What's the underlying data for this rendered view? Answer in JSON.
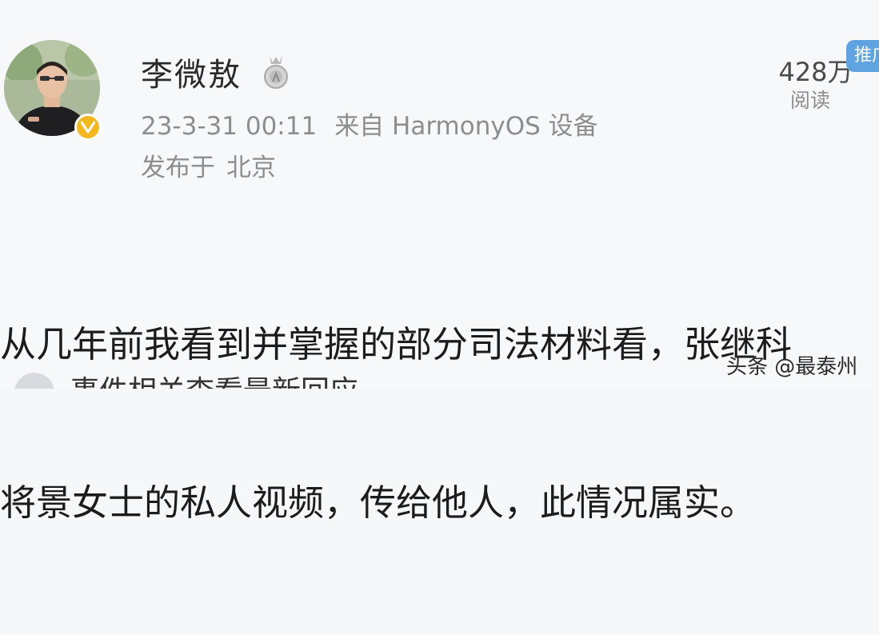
{
  "post": {
    "author": {
      "name": "李微敖",
      "avatar_icon": "user-photo-avatar",
      "verified_icon": "verified-v-badge-icon",
      "medal_icon": "medal-badge-icon"
    },
    "date": "23-3-31 00:11",
    "source": "来自 HarmonyOS 设备",
    "location_prefix": "发布于",
    "location": "北京",
    "read_count": "428万",
    "read_label": "阅读",
    "promo_tag": "推广",
    "body_lines": [
      "从几年前我看到并掌握的部分司法材料看，张继科",
      "将景女士的私人视频，传给他人，此情况属实。"
    ]
  },
  "footer": {
    "topic_icon": "topic-icon",
    "topic_text": "事件相关查看最新回应"
  },
  "watermark": {
    "text": "头条 @最泰州"
  },
  "colors": {
    "background": "#f7f8fa",
    "meta_text": "#8d8d8d",
    "verified_badge": "#f4b81e",
    "promo_tag": "#5fa3e0"
  }
}
